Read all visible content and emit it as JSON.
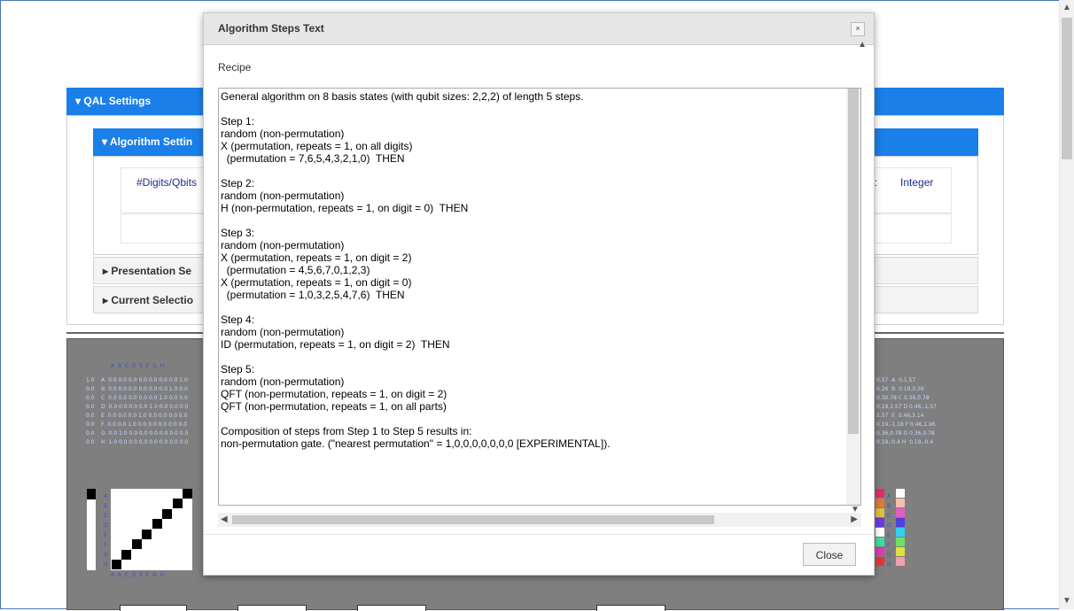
{
  "qal_settings": {
    "title": "QAL Settings"
  },
  "algorithm_settings": {
    "title": "Algorithm Settin",
    "digits_label": "#Digits/Qbits",
    "right_label": "lg.:",
    "right_value": "Integer"
  },
  "presentation_settings": {
    "title": "Presentation Se"
  },
  "current_selection": {
    "title": "Current Selectio"
  },
  "viz": {
    "col_header": "A  B  C  D  E  F  G  H",
    "rows": [
      "1.0    A  0.0 0.0 0.0 0.0 0.0 0.0 0.0 1.0",
      "0.0    B  0.0 0.0 0.0 0.0 0.0 0.0 1.0 0.0",
      "0.0    C  0.0 0.0 0.0 0.0 0.0 1.0 0.0 0.0",
      "0.0    D  0.0 0.0 0.0 0.0 1.0 0.0 0.0 0.0",
      "0.0    E  0.0 0.0 0.0 1.0 0.0 0.0 0.0 0.0",
      "0.0    F  0.0 0.0 1.0 0.0 0.0 0.0 0.0 0.0",
      "0.0    G  0.0 1.0 0.0 0.0 0.0 0.0 0.0 0.0",
      "0.0    H  1.0 0.0 0.0 0.0 0.0 0.0 0.0 0.0"
    ],
    "right_rows": [
      "0.57  A  0,1.57",
      "0.26  B  0.19,0.39",
      "0.30.78 C 0.36,0.78",
      "0.19,1.57 D 0.46,-1.57",
      "1.57  E  0.46,3.14",
      "0.19,-1.18 F 0.46,1.96",
      "0.36,0.78 G 0.36,0.78",
      "0.19,-0.4 H  0.19,-0.4"
    ],
    "matrix_labels": "A  B  C  D  E  F  G  H",
    "side_letters": [
      "A",
      "B",
      "C",
      "D",
      "E",
      "F",
      "G",
      "H"
    ],
    "colors": [
      "#e0306a",
      "#e07a3a",
      "#e0c03a",
      "#6a3ae0",
      "#ffffff",
      "#3ae0a0",
      "#e03ab0",
      "#e03a3a"
    ],
    "colors2": [
      "#ffffff",
      "#f2c0b0",
      "#e060c0",
      "#5040e0",
      "#30d0f0",
      "#70e060",
      "#e0e040",
      "#f0a0b0"
    ]
  },
  "modal": {
    "title": "Algorithm Steps Text",
    "close_x": "×",
    "recipe_label": "Recipe",
    "lines": [
      "General algorithm on 8 basis states (with qubit sizes: 2,2,2) of length 5 steps.",
      "",
      "Step 1:",
      "random (non-permutation)",
      "X (permutation, repeats = 1, on all digits)",
      "  (permutation = 7,6,5,4,3,2,1,0)  THEN",
      "",
      "Step 2:",
      "random (non-permutation)",
      "H (non-permutation, repeats = 1, on digit = 0)  THEN",
      "",
      "Step 3:",
      "random (non-permutation)",
      "X (permutation, repeats = 1, on digit = 2)",
      "  (permutation = 4,5,6,7,0,1,2,3)",
      "X (permutation, repeats = 1, on digit = 0)",
      "  (permutation = 1,0,3,2,5,4,7,6)  THEN",
      "",
      "Step 4:",
      "random (non-permutation)",
      "ID (permutation, repeats = 1, on digit = 2)  THEN",
      "",
      "Step 5:",
      "random (non-permutation)",
      "QFT (non-permutation, repeats = 1, on digit = 2)",
      "QFT (non-permutation, repeats = 1, on all parts)",
      "",
      "Composition of steps from Step 1 to Step 5 results in:",
      "non-permutation gate. (\"nearest permutation\" = 1,0,0,0,0,0,0,0 [EXPERIMENTAL])."
    ],
    "close_button": "Close"
  }
}
